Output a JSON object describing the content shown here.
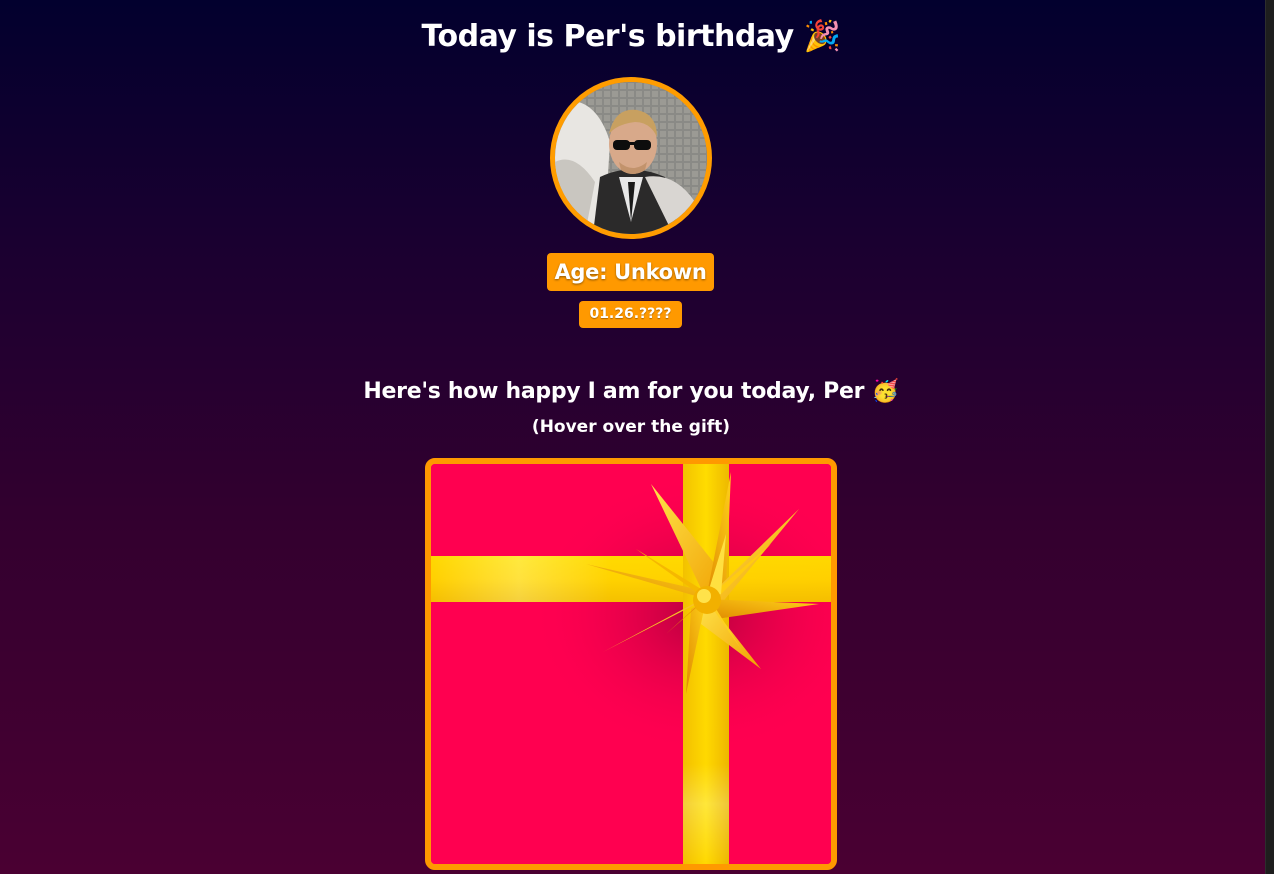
{
  "header": {
    "title": "Today is Per's birthday",
    "title_emoji": "🎉"
  },
  "profile": {
    "avatar_alt": "Per",
    "age_label": "Age: Unkown",
    "date_label": "01.26.????"
  },
  "message": {
    "happy_text": "Here's how happy I am for you today, Per",
    "happy_emoji": "🥳",
    "hint": "(Hover over the gift)"
  },
  "theme": {
    "accent": "#ff9900",
    "gift_color": "#ff0050",
    "ribbon_color": "#ffd400",
    "background_top": "#02002e",
    "background_bottom": "#4a0032"
  },
  "icons": {
    "title_icon": "party-popper-icon",
    "happy_icon": "partying-face-icon",
    "gift_icon": "gift-box-icon",
    "bow_icon": "gold-bow-icon"
  }
}
